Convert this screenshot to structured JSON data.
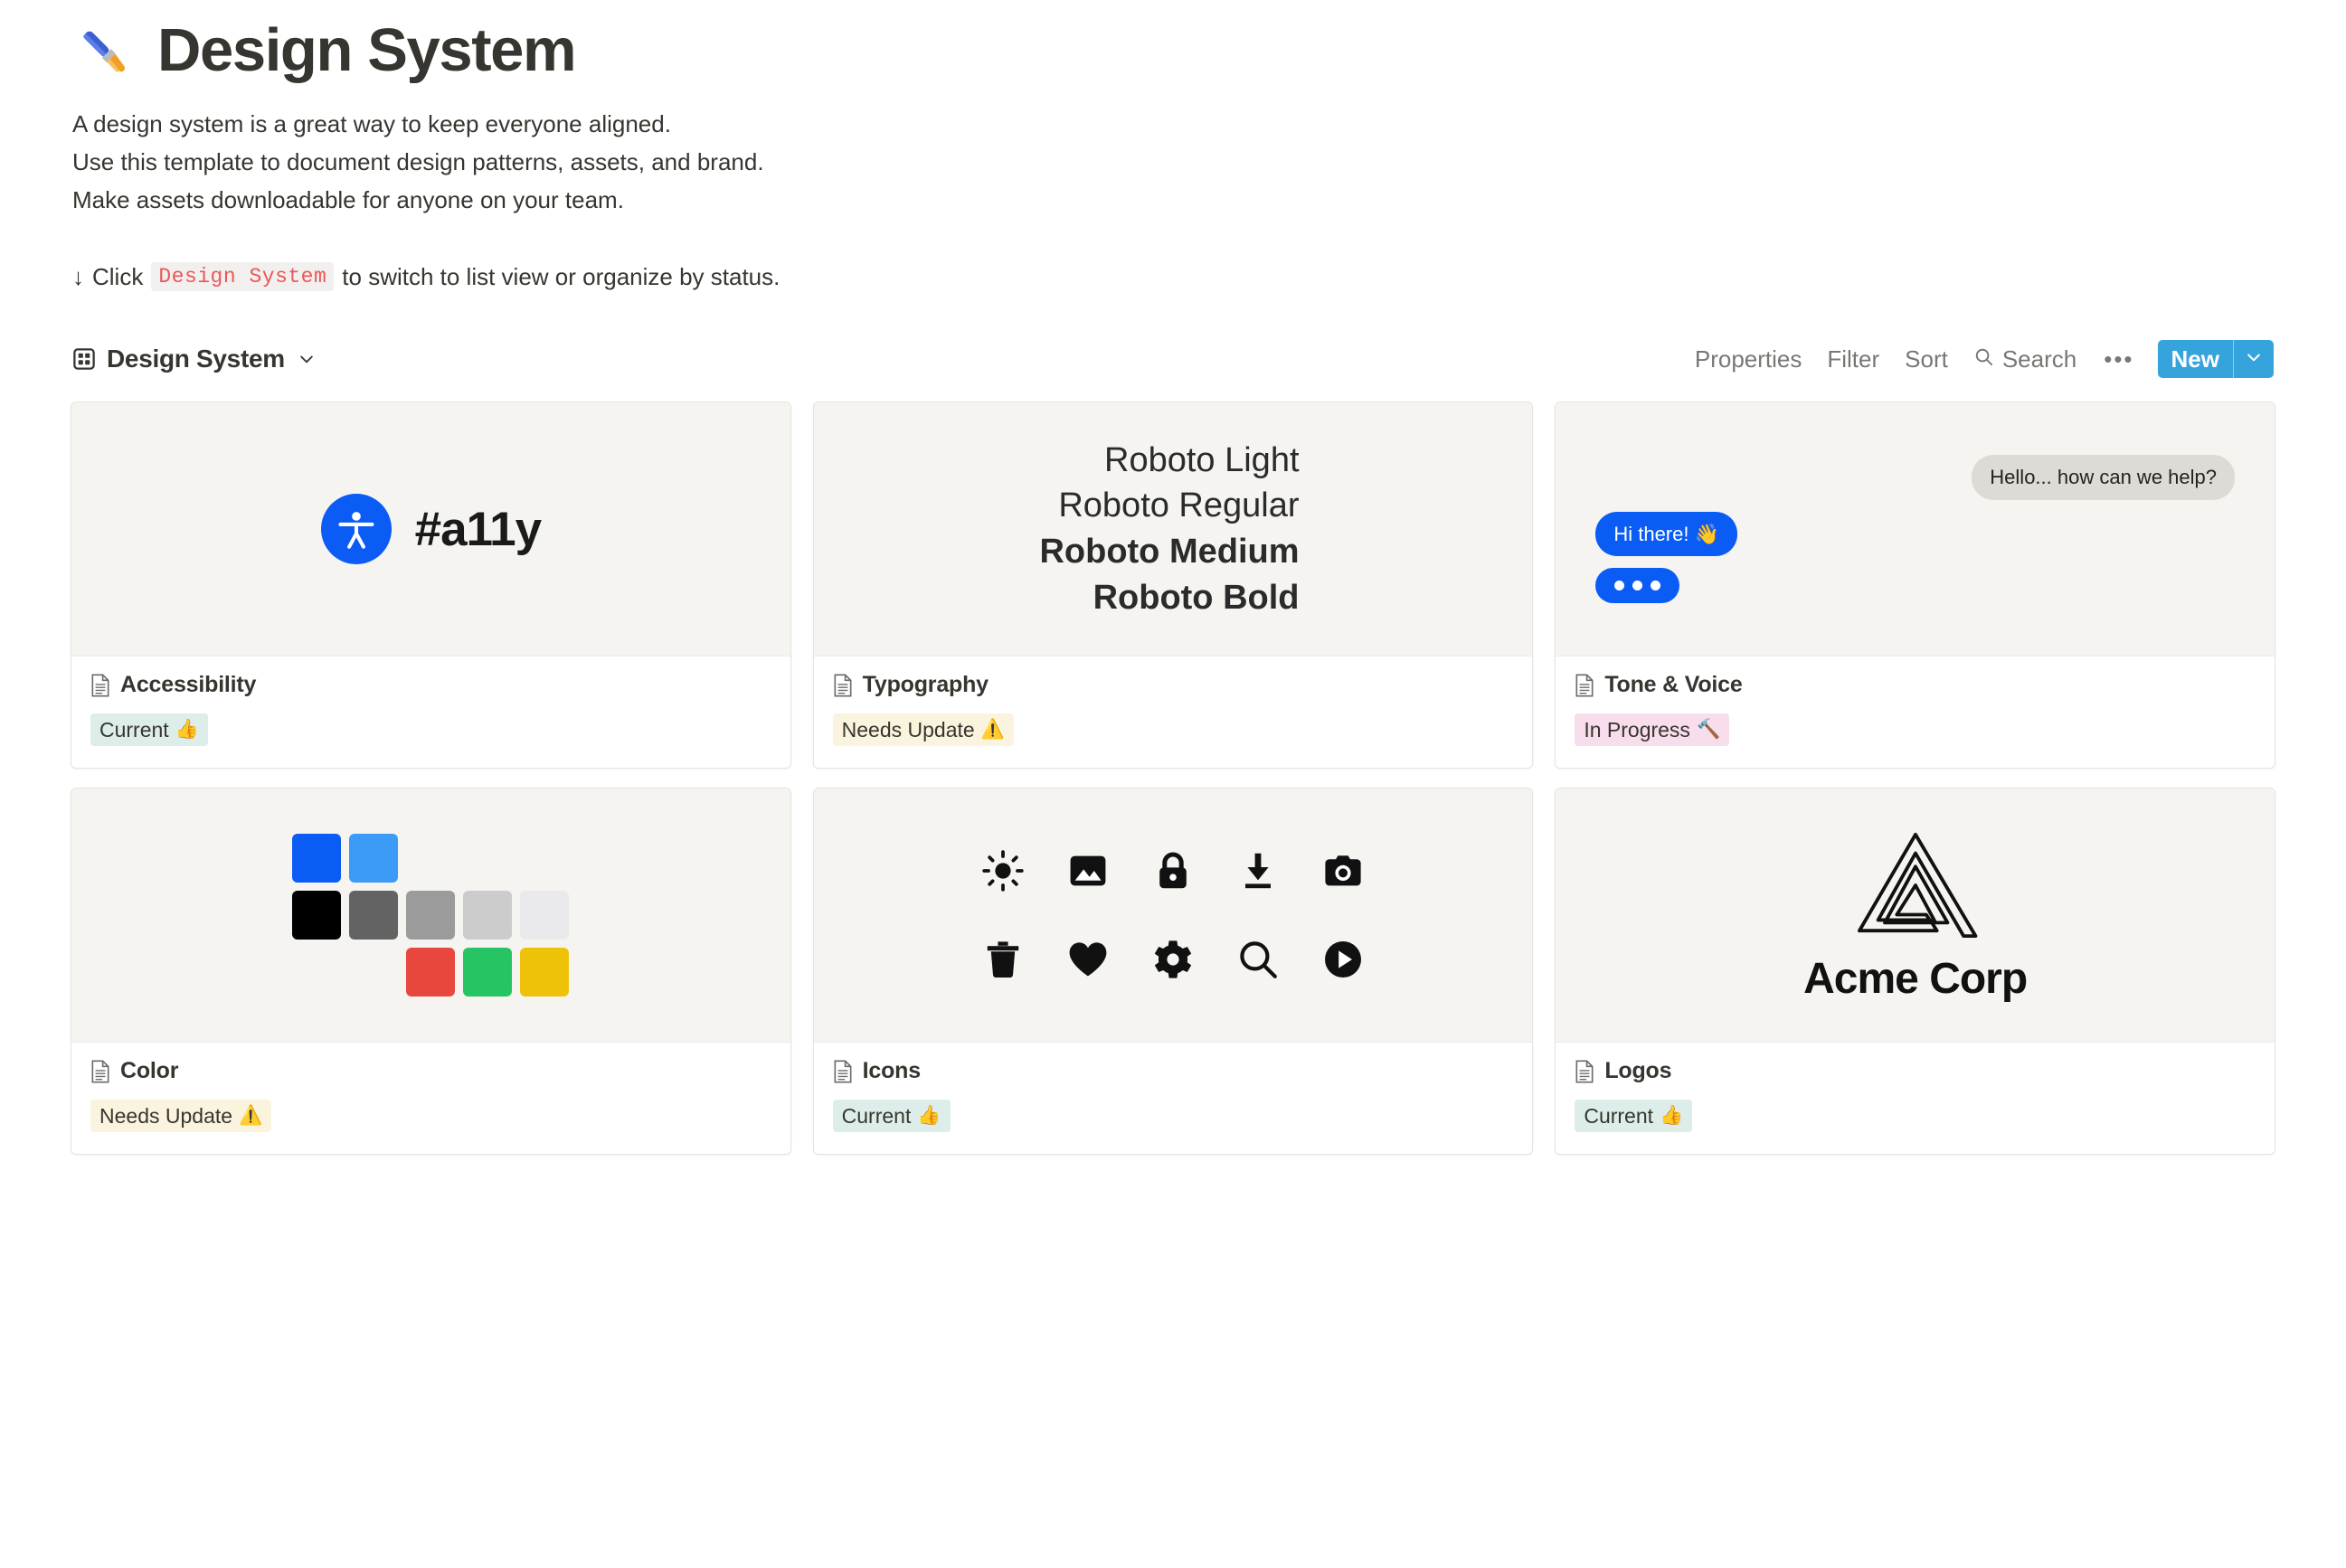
{
  "header": {
    "emoji": "paintbrush-emoji",
    "title": "Design System",
    "description_lines": [
      "A design system is a great way to keep everyone aligned.",
      "Use this template to document design patterns, assets, and brand.",
      "Make assets downloadable for anyone on your team."
    ],
    "hint_arrow": "↓",
    "hint_prefix": "Click",
    "hint_code": "Design System",
    "hint_suffix": "to switch to list view or organize by status."
  },
  "toolbar": {
    "view_icon": "gallery-grid-icon",
    "view_name": "Design System",
    "view_chevron": "chevron-down-icon",
    "properties_label": "Properties",
    "filter_label": "Filter",
    "sort_label": "Sort",
    "search_icon": "search-icon",
    "search_label": "Search",
    "more_label": "•••",
    "new_label": "New",
    "new_chevron": "chevron-down-icon",
    "new_button_color": "#35a4dc"
  },
  "statuses": {
    "current": {
      "label": "Current",
      "emoji": "👍",
      "bg": "#ddedea"
    },
    "needs_update": {
      "label": "Needs Update",
      "emoji": "⚠️",
      "bg": "#faf3dd"
    },
    "in_progress": {
      "label": "In Progress",
      "emoji": "🔨",
      "bg": "#f8ddec"
    }
  },
  "cards": [
    {
      "title": "Accessibility",
      "page_icon": "document-icon",
      "status": {
        "label": "Current",
        "emoji": "👍",
        "class": "current"
      },
      "media": {
        "type": "a11y",
        "text": "#a11y",
        "accent": "#0a5cf5"
      }
    },
    {
      "title": "Typography",
      "page_icon": "document-icon",
      "status": {
        "label": "Needs Update",
        "emoji": "⚠️",
        "class": "needs"
      },
      "media": {
        "type": "typography",
        "samples": [
          "Roboto Light",
          "Roboto Regular",
          "Roboto Medium",
          "Roboto Bold"
        ]
      }
    },
    {
      "title": "Tone & Voice",
      "page_icon": "document-icon",
      "status": {
        "label": "In Progress",
        "emoji": "🔨",
        "class": "progress"
      },
      "media": {
        "type": "chat",
        "messages": [
          {
            "from": "them",
            "text": "Hello... how can we help?"
          },
          {
            "from": "me",
            "text": "Hi there! 👋"
          },
          {
            "from": "me",
            "text": "typing-indicator"
          }
        ]
      }
    },
    {
      "title": "Color",
      "page_icon": "document-icon",
      "status": {
        "label": "Needs Update",
        "emoji": "⚠️",
        "class": "needs"
      },
      "media": {
        "type": "swatches",
        "rows": [
          [
            "#0a5cf5",
            "#3b9bf7",
            null,
            null,
            null
          ],
          [
            "#000000",
            "#636363",
            "#9b9b9b",
            "#cccccc",
            "#eaeaec"
          ],
          [
            null,
            null,
            "#e8473f",
            "#27c463",
            "#edc208"
          ]
        ]
      }
    },
    {
      "title": "Icons",
      "page_icon": "document-icon",
      "status": {
        "label": "Current",
        "emoji": "👍",
        "class": "current"
      },
      "media": {
        "type": "icons",
        "names": [
          "brightness-icon",
          "image-icon",
          "lock-icon",
          "download-icon",
          "camera-icon",
          "trash-icon",
          "heart-icon",
          "gear-icon",
          "search-icon",
          "play-circle-icon"
        ]
      }
    },
    {
      "title": "Logos",
      "page_icon": "document-icon",
      "status": {
        "label": "Current",
        "emoji": "👍",
        "class": "current"
      },
      "media": {
        "type": "logo",
        "mark": "penrose-triangle-icon",
        "name": "Acme Corp"
      }
    }
  ]
}
